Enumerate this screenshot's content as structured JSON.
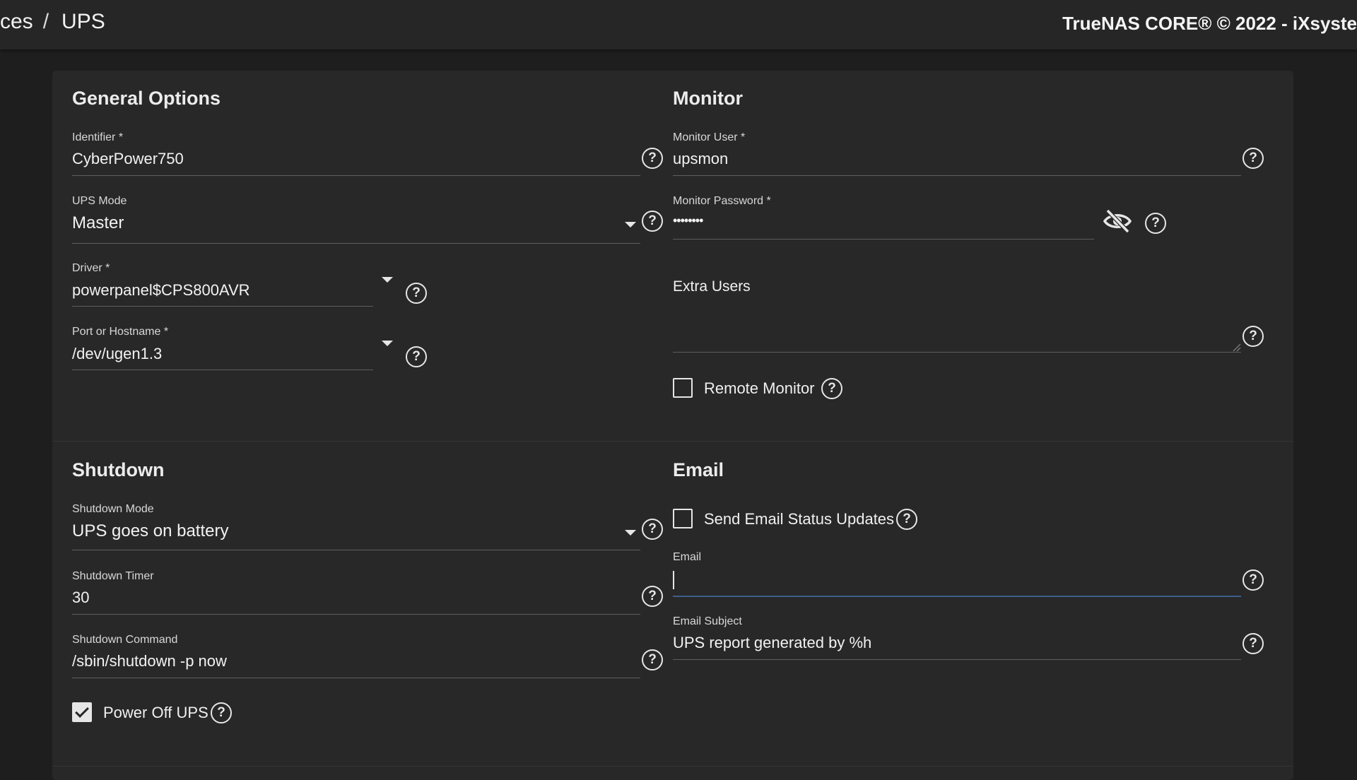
{
  "topbar": {
    "breadcrumb_parent": "ces",
    "breadcrumb_sep": "/",
    "breadcrumb_current": "UPS",
    "copyright": "TrueNAS CORE® © 2022 - iXsyste"
  },
  "general": {
    "title": "General Options",
    "identifier": {
      "label": "Identifier *",
      "value": "CyberPower750"
    },
    "ups_mode": {
      "label": "UPS Mode",
      "value": "Master"
    },
    "driver": {
      "label": "Driver *",
      "value": "powerpanel$CPS800AVR"
    },
    "port": {
      "label": "Port or Hostname *",
      "value": "/dev/ugen1.3"
    }
  },
  "monitor": {
    "title": "Monitor",
    "user": {
      "label": "Monitor User *",
      "value": "upsmon"
    },
    "password": {
      "label": "Monitor Password *",
      "value": "••••••••"
    },
    "extra_users": {
      "label": "Extra Users",
      "value": ""
    },
    "remote_monitor": {
      "label": "Remote Monitor",
      "checked": false
    }
  },
  "shutdown": {
    "title": "Shutdown",
    "mode": {
      "label": "Shutdown Mode",
      "value": "UPS goes on battery"
    },
    "timer": {
      "label": "Shutdown Timer",
      "value": "30"
    },
    "command": {
      "label": "Shutdown Command",
      "value": "/sbin/shutdown -p now"
    },
    "power_off": {
      "label": "Power Off UPS",
      "checked": true
    }
  },
  "email": {
    "title": "Email",
    "send_updates": {
      "label": "Send Email Status Updates",
      "checked": false
    },
    "email": {
      "label": "Email",
      "value": ""
    },
    "subject": {
      "label": "Email Subject",
      "value": "UPS report generated by %h"
    }
  },
  "icons": {
    "help": "help-circle-icon",
    "visibility": "eye-off-icon",
    "dropdown": "chevron-down-icon",
    "check": "check-icon"
  },
  "help_glyph": "?"
}
